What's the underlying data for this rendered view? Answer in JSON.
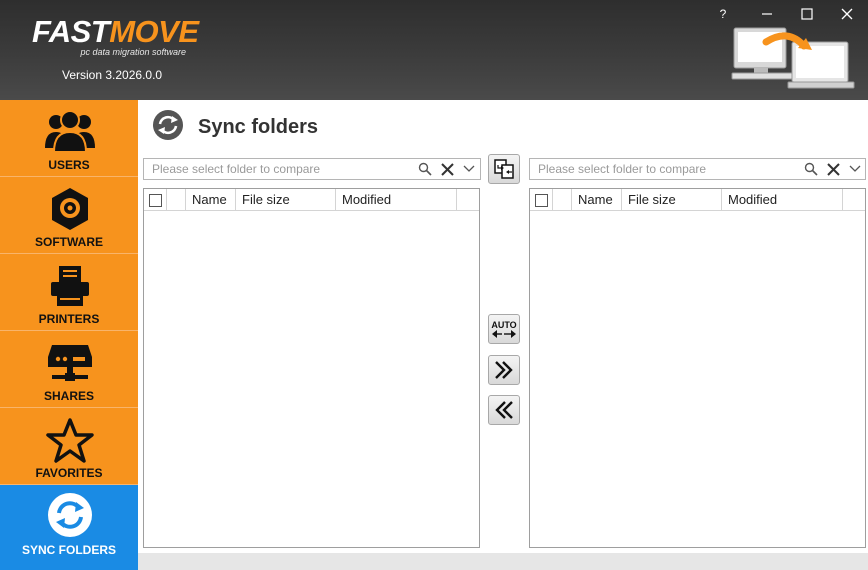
{
  "app": {
    "logo_part1": "FAST",
    "logo_part2": "MOVE",
    "tagline": "pc data migration software",
    "version": "Version 3.2026.0.0"
  },
  "window_controls": {
    "help": "?",
    "minimize": "—",
    "maximize": "☐",
    "close": "✕"
  },
  "sidebar": {
    "items": [
      {
        "label": "USERS",
        "icon": "users-icon",
        "active": false
      },
      {
        "label": "SOFTWARE",
        "icon": "software-icon",
        "active": false
      },
      {
        "label": "PRINTERS",
        "icon": "printer-icon",
        "active": false
      },
      {
        "label": "SHARES",
        "icon": "shares-icon",
        "active": false
      },
      {
        "label": "FAVORITES",
        "icon": "star-icon",
        "active": false
      },
      {
        "label": "SYNC FOLDERS",
        "icon": "sync-icon",
        "active": true
      }
    ]
  },
  "page": {
    "title": "Sync folders"
  },
  "left_pane": {
    "placeholder": "Please select folder to compare",
    "columns": [
      "Name",
      "File size",
      "Modified"
    ],
    "rows": []
  },
  "right_pane": {
    "placeholder": "Please select folder to compare",
    "columns": [
      "Name",
      "File size",
      "Modified"
    ],
    "rows": []
  },
  "middle_buttons": {
    "auto_label": "AUTO"
  },
  "colors": {
    "accent_orange": "#f7931d",
    "active_blue": "#1a8be4",
    "header_dark": "#3a3a3a"
  }
}
